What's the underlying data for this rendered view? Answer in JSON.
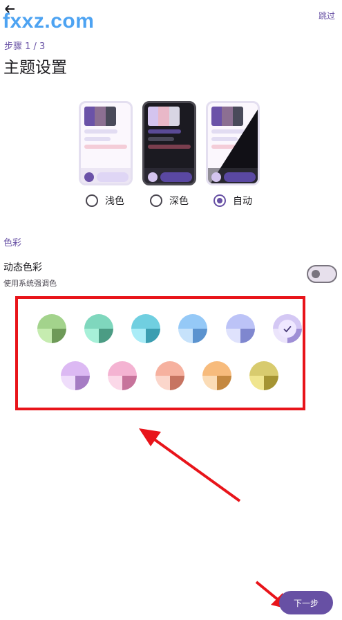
{
  "watermark": "fxxz.com",
  "header": {
    "skip_label": "跳过",
    "step": "步骤 1 / 3",
    "title": "主题设置"
  },
  "theme_modes": [
    {
      "label": "浅色",
      "selected": false
    },
    {
      "label": "深色",
      "selected": false
    },
    {
      "label": "自动",
      "selected": true
    }
  ],
  "color_section": {
    "heading": "色彩",
    "dynamic_title": "动态色彩",
    "dynamic_subtitle": "使用系统强调色",
    "dynamic_enabled": false
  },
  "swatches": [
    {
      "top": "#a3d38c",
      "bl": "#c6ecb0",
      "br": "#6e9a58",
      "selected": false
    },
    {
      "top": "#7fd7bd",
      "bl": "#a7f0d8",
      "br": "#4b9c84",
      "selected": false
    },
    {
      "top": "#70cfe0",
      "bl": "#a9ecf7",
      "br": "#3b9eb1",
      "selected": false
    },
    {
      "top": "#95c9f7",
      "bl": "#c6e2fb",
      "br": "#5b93cf",
      "selected": false
    },
    {
      "top": "#bcc3f7",
      "bl": "#dfe2fc",
      "br": "#7f87cf",
      "selected": false
    },
    {
      "top": "#d4c8f4",
      "bl": "#ebe4fb",
      "br": "#9f8fd6",
      "selected": true
    },
    {
      "top": "#dcb9f3",
      "bl": "#efddfb",
      "br": "#a67cc4",
      "selected": false
    },
    {
      "top": "#f4b3d2",
      "bl": "#fbd8e8",
      "br": "#c7739b",
      "selected": false
    },
    {
      "top": "#f6b19f",
      "bl": "#fbd6cb",
      "br": "#c77461",
      "selected": false
    },
    {
      "top": "#f7bb7c",
      "bl": "#fbdcb6",
      "br": "#c48840",
      "selected": false
    },
    {
      "top": "#d8cb6e",
      "bl": "#f0e58e",
      "br": "#a59433",
      "selected": false
    }
  ],
  "footer": {
    "next_label": "下一步"
  },
  "colors": {
    "accent": "#6750a4",
    "highlight": "#e8141a",
    "watermark": "#4da3f2"
  }
}
